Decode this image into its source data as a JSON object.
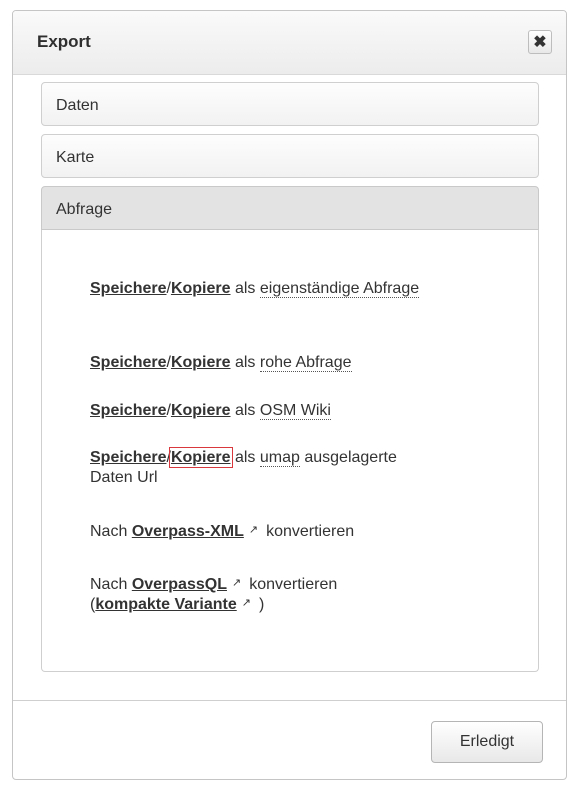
{
  "dialog": {
    "title": "Export",
    "close_glyph": "✖"
  },
  "accordion": {
    "sections": [
      {
        "label": "Daten"
      },
      {
        "label": "Karte"
      },
      {
        "label": "Abfrage"
      }
    ]
  },
  "query_panel": {
    "save": "Speichere",
    "slash": "/",
    "copy": "Kopiere",
    "as": "als",
    "standalone_query": "eigenständige Abfrage",
    "raw_query": "rohe Abfrage",
    "osm_wiki": "OSM Wiki",
    "umap": "umap",
    "umap_rest_line1": "ausgelagerte",
    "umap_rest_line2": "Daten Url",
    "convert_to": "Nach",
    "overpass_xml": "Overpass-XML",
    "convert": "konvertieren",
    "overpass_ql": "OverpassQL",
    "open_paren": "(",
    "compact_variant": "kompakte Variante",
    "close_paren": ")",
    "external_link_glyph": "↗"
  },
  "footer": {
    "done_label": "Erledigt"
  },
  "icons": [
    "close-icon",
    "external-link-icon"
  ]
}
